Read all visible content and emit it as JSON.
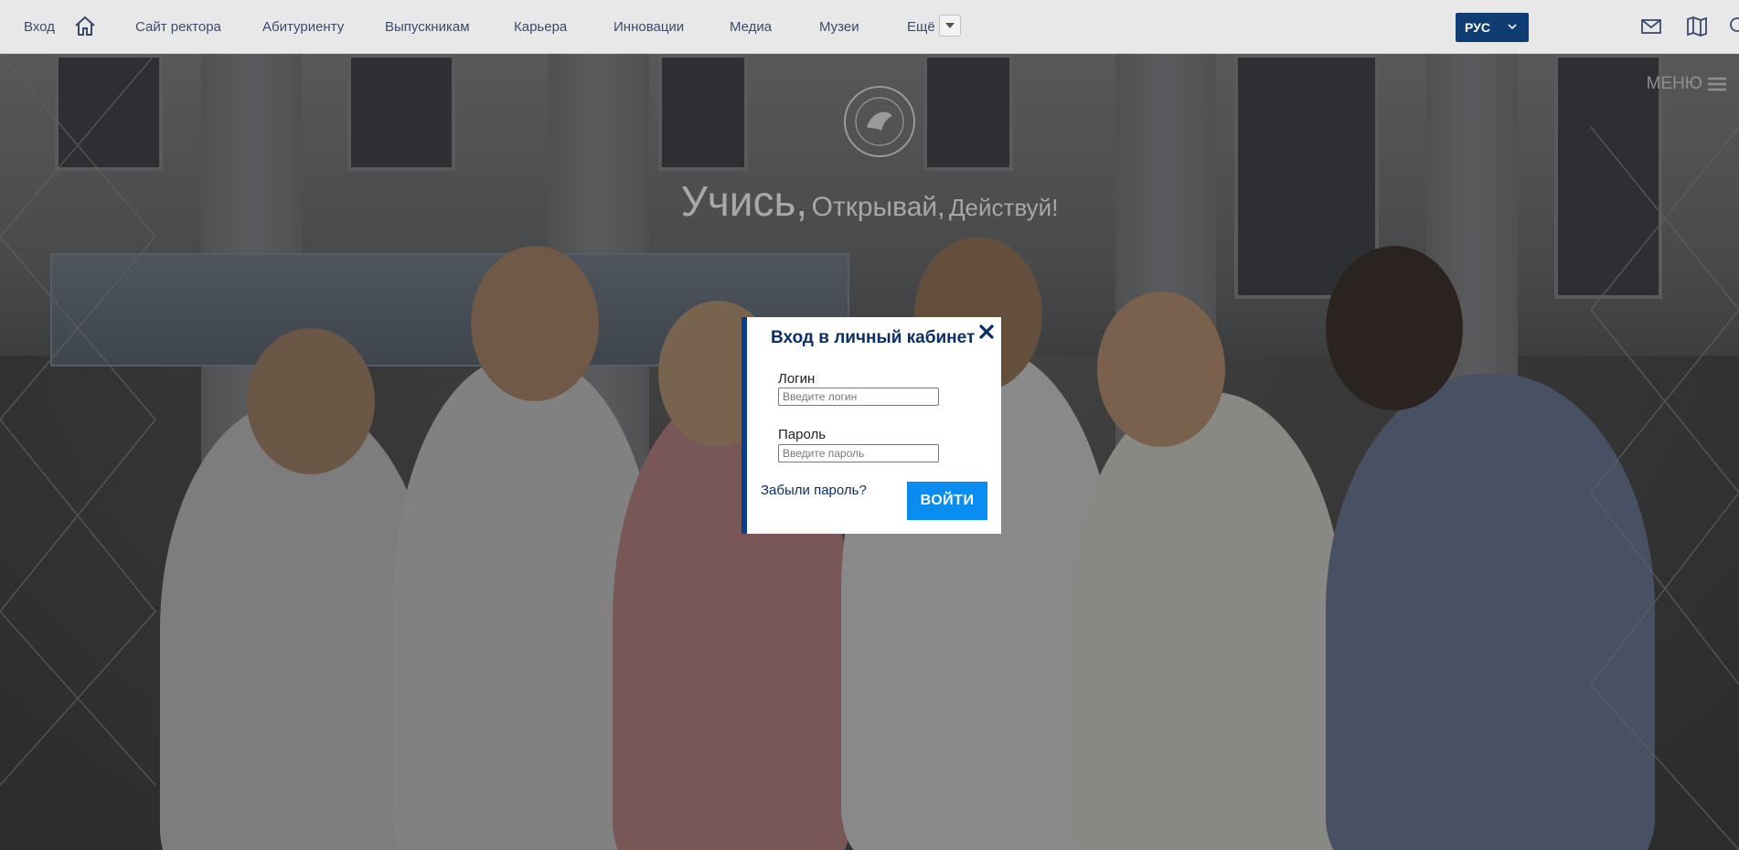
{
  "topbar": {
    "login_link": "Вход",
    "nav": [
      {
        "label": "Сайт ректора"
      },
      {
        "label": "Абитуриенту"
      },
      {
        "label": "Выпускникам"
      },
      {
        "label": "Карьера"
      },
      {
        "label": "Инновации"
      },
      {
        "label": "Медиа"
      },
      {
        "label": "Музеи"
      },
      {
        "label": "Ещё"
      }
    ],
    "language": "РУС"
  },
  "hero": {
    "slogan_1": "Учись,",
    "slogan_2": "Открывай,",
    "slogan_3": "Действуй!",
    "menu_label": "МЕНЮ"
  },
  "modal": {
    "title": "Вход в личный кабинет",
    "login_label": "Логин",
    "login_placeholder": "Введите логин",
    "password_label": "Пароль",
    "password_placeholder": "Введите пароль",
    "forgot_link": "Забыли пароль?",
    "submit_label": "ВОЙТИ"
  },
  "colors": {
    "brand_dark": "#0a3e8a",
    "button_blue": "#0a8cf0",
    "lang_bg": "#0f3d73"
  }
}
